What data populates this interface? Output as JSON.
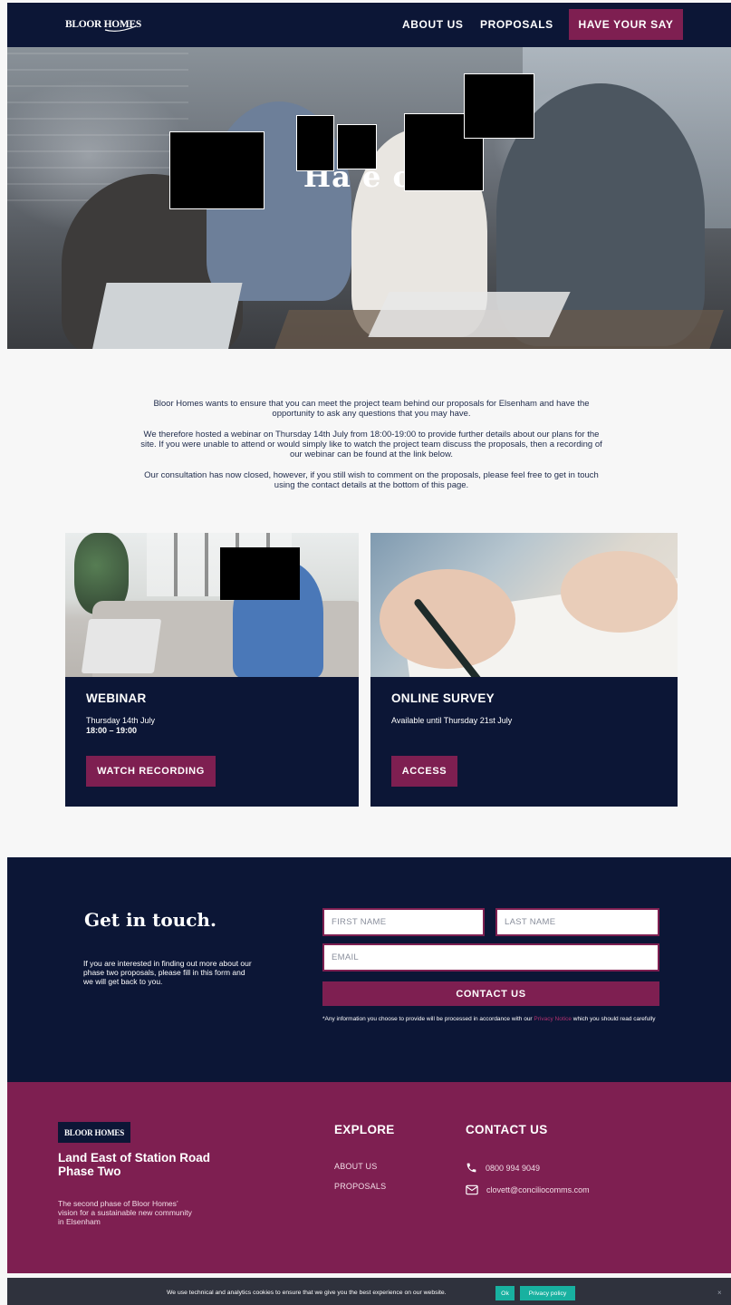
{
  "header": {
    "logo_text": "BLOOR HOMES",
    "nav": {
      "about": "ABOUT US",
      "proposals": "PROPOSALS",
      "cta": "HAVE YOUR SAY"
    }
  },
  "hero": {
    "title": "Ha e ou"
  },
  "intro": {
    "p1": "Bloor Homes wants to ensure that you can meet the project team behind our proposals for Elsenham and have the opportunity to ask any questions that you may have.",
    "p2": "We therefore hosted a webinar on Thursday 14th July from 18:00-19:00 to provide further details about our plans for the site. If you were unable to attend or would simply like to watch the project team discuss the proposals, then a recording of our webinar can be found at the link below.",
    "p3": "Our consultation has now closed, however, if you still wish to comment on the proposals, please feel free to get in touch using the contact details at the bottom of this page."
  },
  "cards": {
    "webinar": {
      "title": "WEBINAR",
      "date": "Thursday 14th July",
      "time": "18:00 – 19:00",
      "button": "WATCH RECORDING"
    },
    "survey": {
      "title": "ONLINE SURVEY",
      "availability": "Available until Thursday 21st July",
      "button": "ACCESS"
    }
  },
  "contact": {
    "title": "Get in touch.",
    "text": "If you are interested in finding out more about our phase two proposals, please fill in this form and we will get back to you.",
    "fields": {
      "first_name": "FIRST NAME",
      "last_name": "LAST NAME",
      "email": "EMAIL"
    },
    "button": "CONTACT US",
    "disclaimer_before": "*Any information you choose to provide will be processed in accordance with our ",
    "disclaimer_link": "Privacy Notice",
    "disclaimer_after": " which you should read carefully"
  },
  "footer": {
    "logo_text": "BLOOR HOMES",
    "title": "Land East of Station Road Phase Two",
    "description": "The second phase of Bloor Homes’ vision for a sustainable new community in Elsenham",
    "explore": {
      "heading": "EXPLORE",
      "links": [
        "ABOUT US",
        "PROPOSALS"
      ]
    },
    "contact": {
      "heading": "CONTACT US",
      "phone": "0800 994 9049",
      "email": "clovett@conciliocomms.com"
    }
  },
  "cookie": {
    "text": "We use technical and analytics cookies to ensure that we give you the best experience on our website.",
    "ok": "Ok",
    "policy": "Privacy policy",
    "close": "×"
  },
  "colors": {
    "navy": "#0c1636",
    "plum": "#7e1f51",
    "teal": "#18b1a0",
    "background": "#f7f7f7"
  }
}
